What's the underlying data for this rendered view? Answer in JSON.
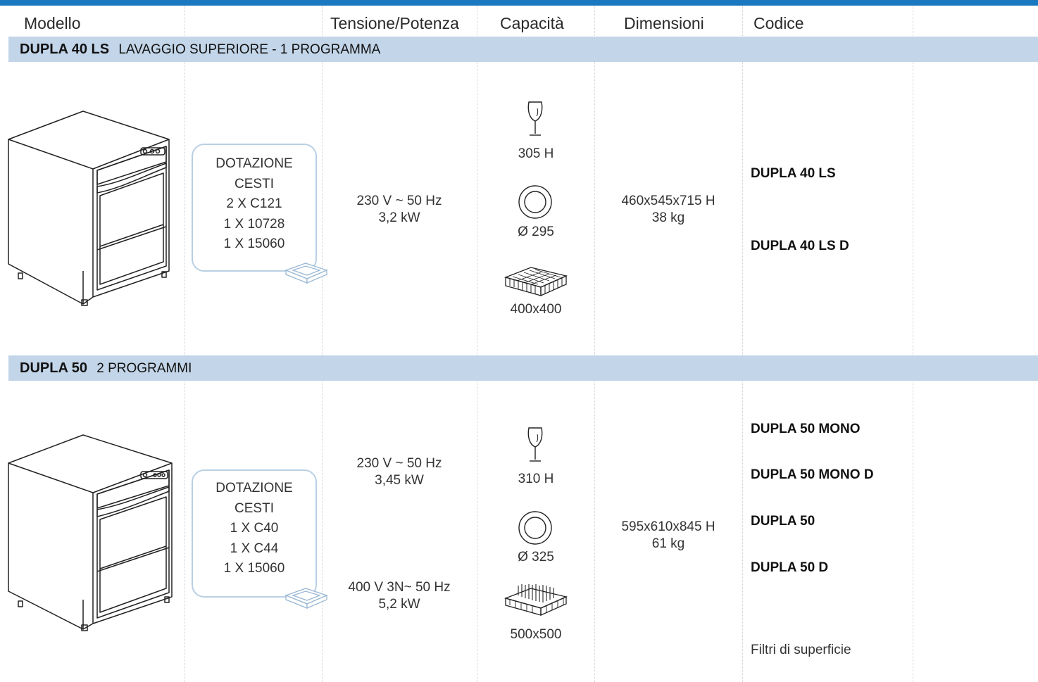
{
  "header": {
    "modello": "Modello",
    "tensione": "Tensione/Potenza",
    "capacita": "Capacità",
    "dimensioni": "Dimensioni",
    "codice": "Codice"
  },
  "sections": [
    {
      "name": "DUPLA 40 LS",
      "subtitle": "LAVAGGIO SUPERIORE  - 1 PROGRAMMA",
      "dotazione": [
        "DOTAZIONE",
        "CESTI",
        "2 X C121",
        "1 X 10728",
        "1 X 15060"
      ],
      "power": [
        {
          "voltage": "230 V ~ 50 Hz",
          "power": "3,2 kW"
        }
      ],
      "capacity": {
        "glass": "305 H",
        "plate": "Ø 295",
        "basket": "400x400"
      },
      "dimensions": "460x545x715 H",
      "weight": "38 kg",
      "codes": [
        "DUPLA 40 LS",
        "DUPLA 40 LS D"
      ]
    },
    {
      "name": "DUPLA 50",
      "subtitle": "2 PROGRAMMI",
      "dotazione": [
        "DOTAZIONE",
        "CESTI",
        "1 X C40",
        "1 X C44",
        "1 X 15060"
      ],
      "power": [
        {
          "voltage": "230 V ~ 50 Hz",
          "power": "3,45 kW"
        },
        {
          "voltage": "400 V 3N~ 50 Hz",
          "power": "5,2 kW"
        }
      ],
      "capacity": {
        "glass": "310 H",
        "plate": "Ø 325",
        "basket": "500x500"
      },
      "dimensions": "595x610x845 H",
      "weight": "61 kg",
      "codes": [
        "DUPLA 50 MONO",
        "DUPLA 50 MONO D",
        "DUPLA 50",
        "DUPLA 50 D"
      ],
      "note": "Filtri di superficie"
    }
  ],
  "colors": {
    "accent": "#1a78c0",
    "band": "#c3d5e8",
    "box_border": "#b9cfe4"
  }
}
